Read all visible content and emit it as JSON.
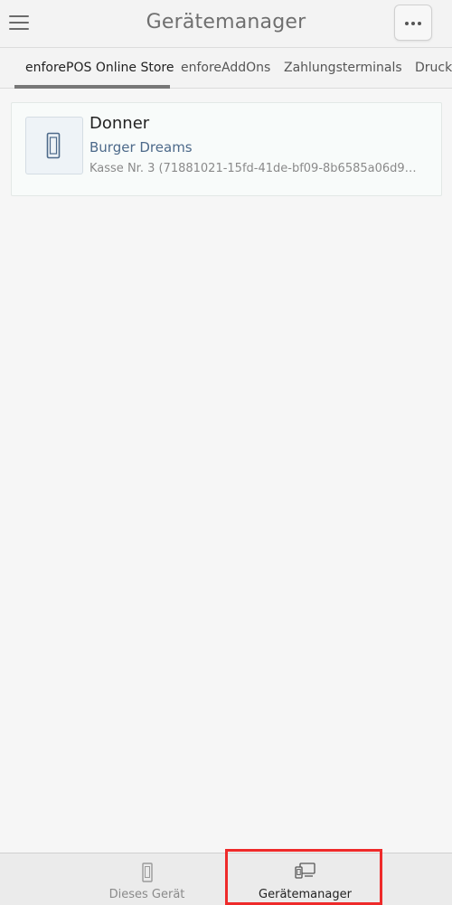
{
  "header": {
    "title": "Gerätemanager"
  },
  "tabs": [
    {
      "label": "enforePOS Online Store",
      "active": true
    },
    {
      "label": "enforeAddOns",
      "active": false
    },
    {
      "label": "Zahlungsterminals",
      "active": false
    },
    {
      "label": "Drucker",
      "active": false
    }
  ],
  "devices": [
    {
      "name": "Donner",
      "shop": "Burger Dreams",
      "detail": "Kasse Nr. 3 (71881021-15fd-41de-bf09-8b6585a06d9…"
    }
  ],
  "bottom_nav": {
    "items": [
      {
        "label": "Dieses Gerät",
        "icon": "phone-icon",
        "active": false
      },
      {
        "label": "Gerätemanager",
        "icon": "devices-icon",
        "active": true
      }
    ]
  },
  "colors": {
    "header_bg": "#f3f3f3",
    "shop_link": "#4d6a8a",
    "highlight": "#ee2a2a"
  }
}
